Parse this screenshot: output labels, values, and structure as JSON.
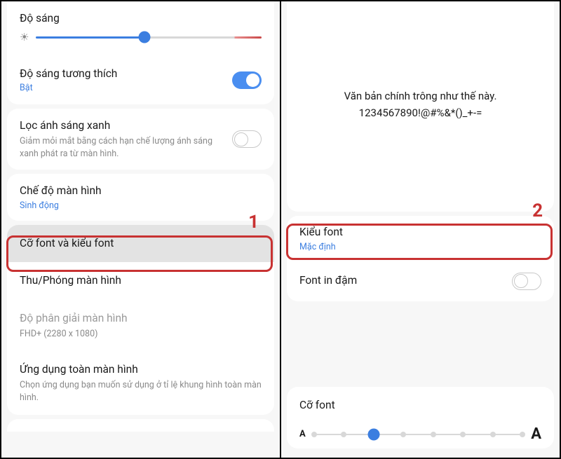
{
  "left": {
    "brightness_label": "Độ sáng",
    "adaptive_brightness": {
      "title": "Độ sáng tương thích",
      "status": "Bật"
    },
    "blue_light": {
      "title": "Lọc ánh sáng xanh",
      "desc": "Giảm mỏi mắt bằng cách hạn chế lượng ánh sáng xanh phát ra từ màn hình."
    },
    "screen_mode": {
      "title": "Chế độ màn hình",
      "status": "Sinh động"
    },
    "font_size_style": "Cỡ font và kiểu font",
    "screen_zoom": "Thu/Phóng màn hình",
    "resolution": {
      "title": "Độ phân giải màn hình",
      "value": "FHD+ (2280 x 1080)"
    },
    "fullscreen_apps": {
      "title": "Ứng dụng toàn màn hình",
      "desc": "Chọn ứng dụng bạn muốn sử dụng ở tỉ lệ khung hình toàn màn hình."
    },
    "annotation": "1"
  },
  "right": {
    "preview_line1": "Văn bản chính trông như thế này.",
    "preview_line2": "1234567890!@#%&*()_+-=",
    "font_style": {
      "title": "Kiểu font",
      "value": "Mặc định"
    },
    "bold_font": "Font in đậm",
    "font_size": "Cỡ font",
    "annotation": "2"
  }
}
